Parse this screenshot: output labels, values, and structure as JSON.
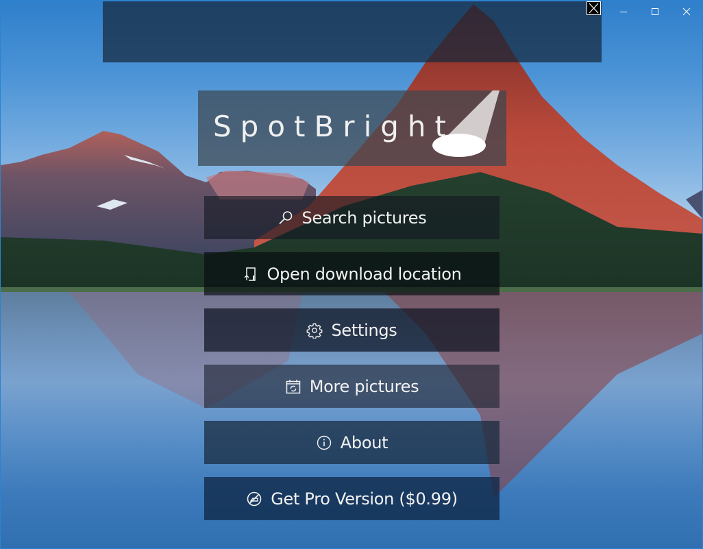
{
  "window": {
    "controls": {
      "minimize_icon": "minimize-icon",
      "maximize_icon": "maximize-icon",
      "close_icon": "close-icon"
    }
  },
  "ad": {
    "close_icon": "close-icon"
  },
  "logo": {
    "title": "SpotBright",
    "icon": "spotlight-icon"
  },
  "menu": [
    {
      "label": "Search pictures",
      "icon": "search-icon"
    },
    {
      "label": "Open download location",
      "icon": "folder-open-icon"
    },
    {
      "label": "Settings",
      "icon": "gear-icon"
    },
    {
      "label": "More pictures",
      "icon": "calendar-refresh-icon"
    },
    {
      "label": "About",
      "icon": "info-icon"
    },
    {
      "label": "Get Pro Version ($0.99)",
      "icon": "no-ads-icon"
    }
  ],
  "colors": {
    "window_border": "#2b83d1",
    "text": "#f2f2f2"
  }
}
